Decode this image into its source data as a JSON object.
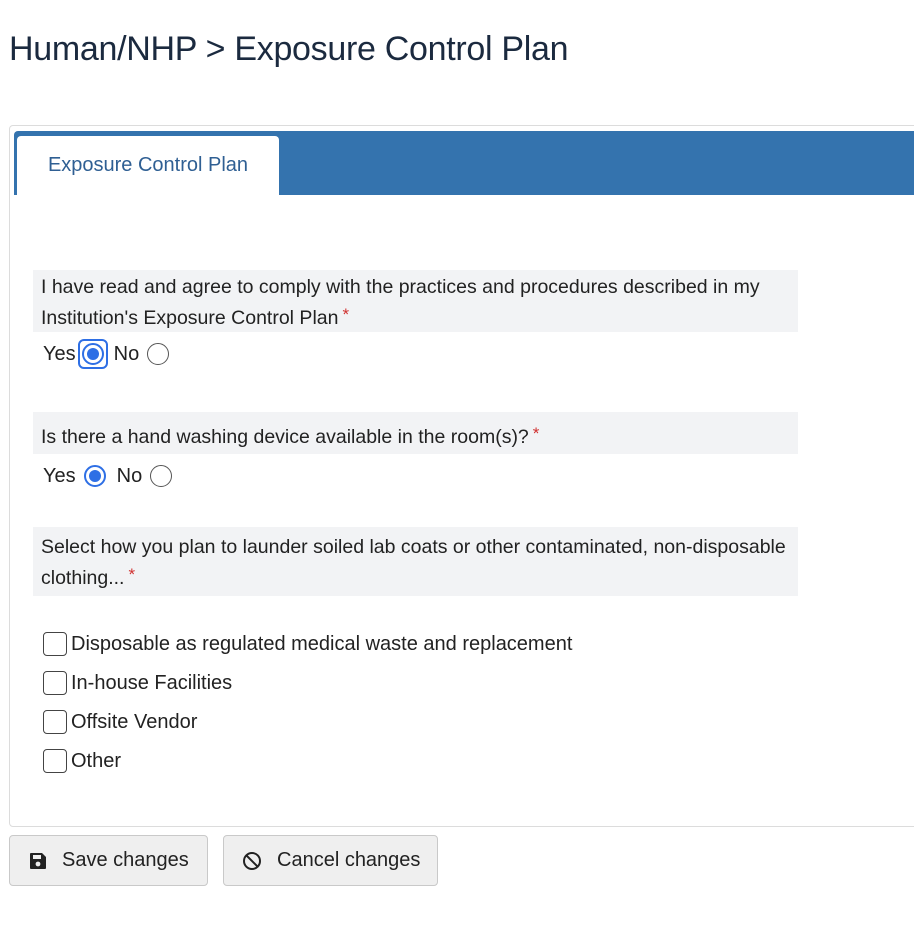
{
  "page": {
    "title": "Human/NHP > Exposure Control Plan"
  },
  "tabs": [
    {
      "label": "Exposure Control Plan",
      "active": true
    }
  ],
  "colors": {
    "tab_bar": "#3473ae",
    "accent": "#2e6fe5",
    "required": "#d0302f"
  },
  "questions": {
    "q1": {
      "label": "I have read and agree to comply with the practices and procedures described in my Institution's Exposure Control Plan",
      "required_mark": "*",
      "options": {
        "yes": "Yes",
        "no": "No"
      },
      "selected": "Yes"
    },
    "q2": {
      "label": "Is there a hand washing device available in the room(s)?",
      "required_mark": "*",
      "options": {
        "yes": "Yes",
        "no": "No"
      },
      "selected": "Yes"
    },
    "q3": {
      "label": "Select how you plan to launder soiled lab coats or other contaminated, non-disposable clothing...",
      "required_mark": "*",
      "options": [
        {
          "label": "Disposable as regulated medical waste and replacement",
          "checked": false
        },
        {
          "label": "In-house Facilities",
          "checked": false
        },
        {
          "label": "Offsite Vendor",
          "checked": false
        },
        {
          "label": "Other",
          "checked": false
        }
      ]
    }
  },
  "actions": {
    "save": {
      "label": "Save changes",
      "icon": "floppy-disk-icon"
    },
    "cancel": {
      "label": "Cancel changes",
      "icon": "ban-icon"
    }
  }
}
